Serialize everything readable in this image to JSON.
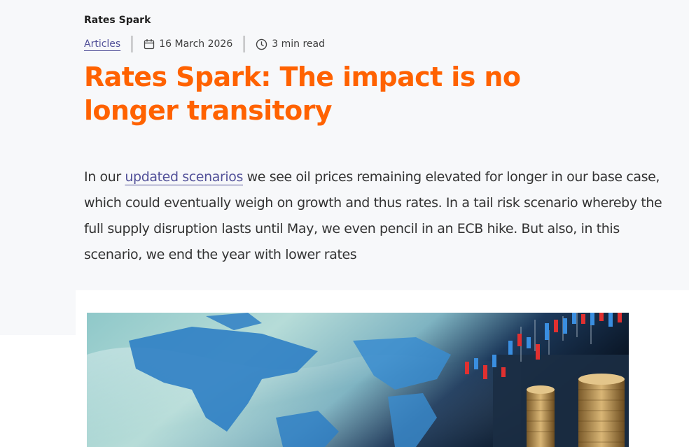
{
  "article": {
    "series": "Rates Spark",
    "category": "Articles",
    "date": "16 March 2026",
    "read_time": "3 min read",
    "title": "Rates Spark: The impact is no longer transitory",
    "lead_link": "updated scenarios",
    "lead_prefix": "In our ",
    "lead_rest": " we see oil prices remaining elevated for longer in our base case, which could eventually weigh on growth and thus rates. In a tail risk scenario whereby the full supply disruption lasts until May, we even pencil in an ECB hike. But also, in this scenario, we end the year with lower rates"
  },
  "colors": {
    "title": "#ff6200",
    "link": "#525199",
    "text": "#333333",
    "background": "#f7f8fa"
  },
  "icons": {
    "date": "calendar-icon",
    "read_time": "clock-icon"
  }
}
